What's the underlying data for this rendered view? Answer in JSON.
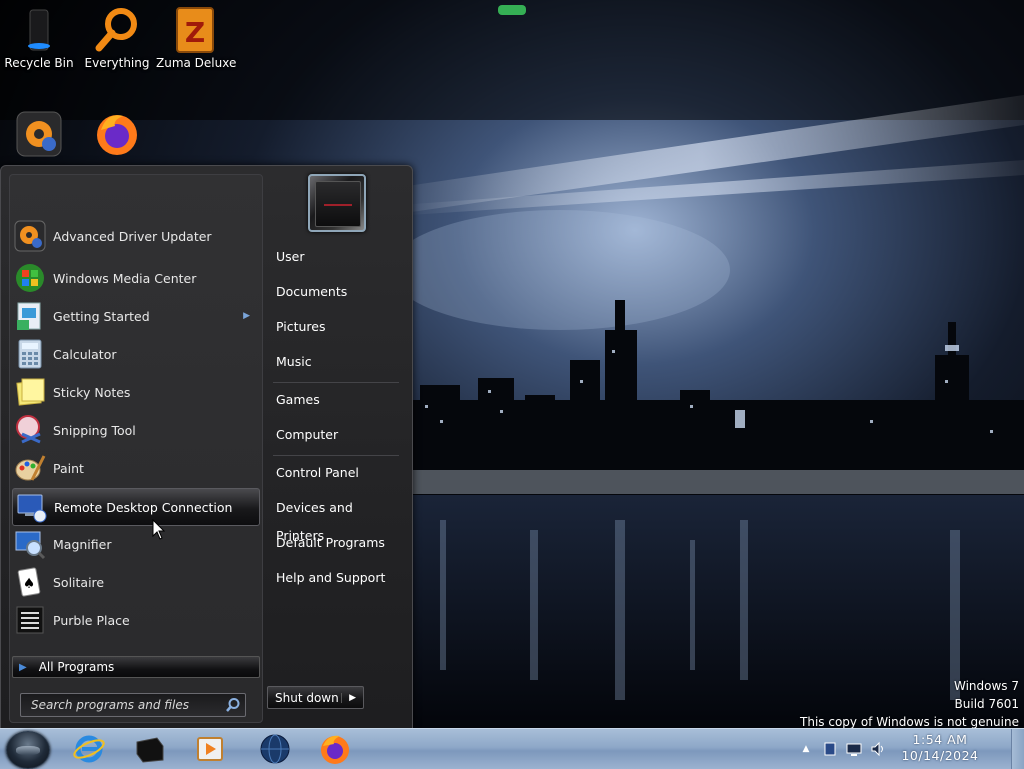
{
  "desktop": {
    "icons": [
      {
        "label": "Recycle Bin",
        "icon": "recycle-bin-icon"
      },
      {
        "label": "Everything",
        "icon": "magnifier-search-icon"
      },
      {
        "label": "Zuma Deluxe",
        "icon": "zuma-deluxe-icon"
      },
      {
        "label": "",
        "icon": "advanced-driver-updater-icon"
      },
      {
        "label": "",
        "icon": "firefox-icon"
      }
    ]
  },
  "start_menu": {
    "programs": [
      {
        "label": "Advanced Driver Updater",
        "icon": "advanced-driver-updater-icon"
      },
      {
        "label": "Windows Media Center",
        "icon": "windows-media-center-icon"
      },
      {
        "label": "Getting Started",
        "icon": "getting-started-icon",
        "has_submenu": true
      },
      {
        "label": "Calculator",
        "icon": "calculator-icon"
      },
      {
        "label": "Sticky Notes",
        "icon": "sticky-notes-icon"
      },
      {
        "label": "Snipping Tool",
        "icon": "snipping-tool-icon"
      },
      {
        "label": "Paint",
        "icon": "paint-icon"
      },
      {
        "label": "Remote Desktop Connection",
        "icon": "remote-desktop-icon",
        "highlighted": true
      },
      {
        "label": "Magnifier",
        "icon": "magnifier-icon"
      },
      {
        "label": "Solitaire",
        "icon": "solitaire-icon"
      },
      {
        "label": "Purble Place",
        "icon": "purble-place-icon"
      }
    ],
    "all_programs_label": "All Programs",
    "search_placeholder": "Search programs and files",
    "right_links": [
      "User",
      "Documents",
      "Pictures",
      "Music",
      "Games",
      "Computer",
      "Control Panel",
      "Devices and Printers",
      "Default Programs",
      "Help and Support"
    ],
    "shutdown_label": "Shut down"
  },
  "watermark": {
    "line1": "Windows 7",
    "line2": "Build 7601",
    "line3": "This copy of Windows is not genuine"
  },
  "taskbar": {
    "pinned": [
      "internet-explorer-icon",
      "black-box-app-icon",
      "media-player-icon",
      "globe-app-icon",
      "firefox-icon"
    ],
    "tray": [
      "show-hidden-icons-chevron",
      "device-icon",
      "network-icon",
      "volume-icon"
    ],
    "clock_time": "1:54 AM",
    "clock_date": "10/14/2024"
  }
}
